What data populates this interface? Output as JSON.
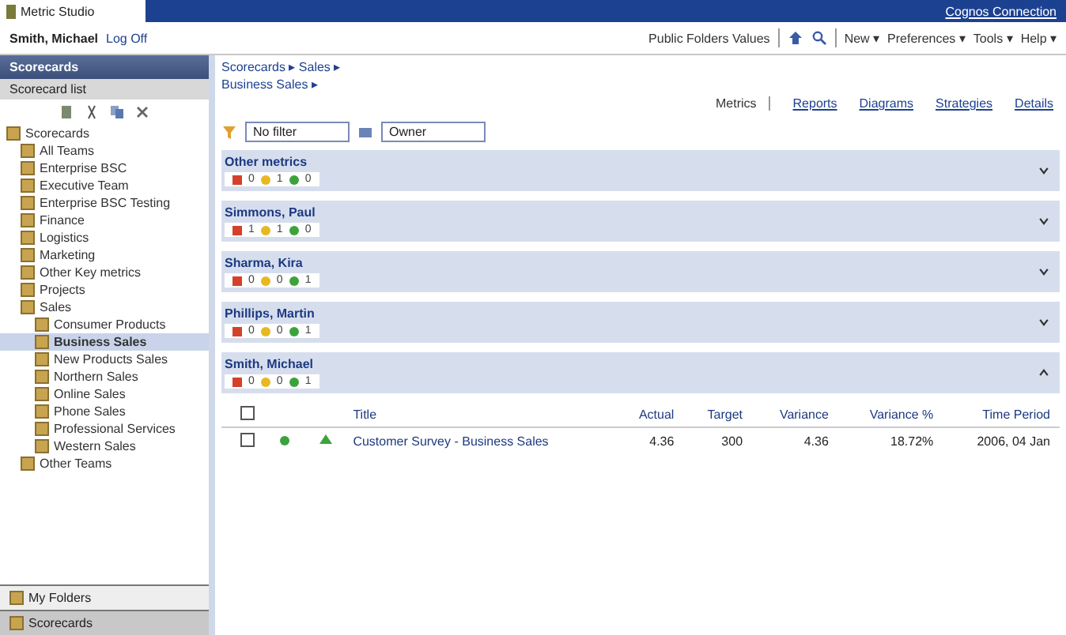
{
  "app_tab": "Metric Studio",
  "cognos_link": "Cognos Connection",
  "user": {
    "name": "Smith, Michael",
    "logoff": "Log Off"
  },
  "toolbar": {
    "folder": "Public Folders Values",
    "menus": [
      "New ▾",
      "Preferences ▾",
      "Tools ▾",
      "Help ▾"
    ]
  },
  "sidebar": {
    "header": "Scorecards",
    "subheader": "Scorecard list",
    "tree": [
      {
        "label": "Scorecards",
        "selected": false,
        "children": [
          {
            "label": "All Teams",
            "selected": false
          },
          {
            "label": "Enterprise BSC",
            "selected": false
          },
          {
            "label": "Executive Team",
            "selected": false
          },
          {
            "label": "Enterprise BSC Testing",
            "selected": false
          },
          {
            "label": "Finance",
            "selected": false
          },
          {
            "label": "Logistics",
            "selected": false
          },
          {
            "label": "Marketing",
            "selected": false
          },
          {
            "label": "Other Key metrics",
            "selected": false
          },
          {
            "label": "Projects",
            "selected": false
          },
          {
            "label": "Sales",
            "selected": false,
            "children": [
              {
                "label": "Consumer Products",
                "selected": false
              },
              {
                "label": "Business Sales",
                "selected": true
              },
              {
                "label": "New Products Sales",
                "selected": false
              },
              {
                "label": "Northern Sales",
                "selected": false
              },
              {
                "label": "Online Sales",
                "selected": false
              },
              {
                "label": "Phone Sales",
                "selected": false
              },
              {
                "label": "Professional Services",
                "selected": false
              },
              {
                "label": "Western Sales",
                "selected": false
              }
            ]
          },
          {
            "label": "Other Teams",
            "selected": false
          }
        ]
      }
    ],
    "bottom": [
      {
        "label": "My Folders",
        "selected": false
      },
      {
        "label": "Scorecards",
        "selected": true
      }
    ]
  },
  "breadcrumb": [
    "Scorecards ▸ Sales ▸",
    "Business Sales ▸"
  ],
  "view_tabs": [
    {
      "label": "Metrics",
      "selected": true
    },
    {
      "label": "Reports",
      "selected": false
    },
    {
      "label": "Diagrams",
      "selected": false
    },
    {
      "label": "Strategies",
      "selected": false
    },
    {
      "label": "Details",
      "selected": false
    }
  ],
  "filters": {
    "filter": "No filter",
    "group": "Owner"
  },
  "groups": [
    {
      "name": "Other metrics",
      "counts": [
        "0",
        "1",
        "0"
      ],
      "expanded": false
    },
    {
      "name": "Simmons, Paul",
      "counts": [
        "1",
        "1",
        "0"
      ],
      "expanded": false
    },
    {
      "name": "Sharma, Kira",
      "counts": [
        "0",
        "0",
        "1"
      ],
      "expanded": false
    },
    {
      "name": "Phillips, Martin",
      "counts": [
        "0",
        "0",
        "1"
      ],
      "expanded": false
    },
    {
      "name": "Smith, Michael",
      "counts": [
        "0",
        "0",
        "1"
      ],
      "expanded": true
    }
  ],
  "table": {
    "select_all_checked": false,
    "columns": [
      "Title",
      "Actual",
      "Target",
      "Variance",
      "Variance %",
      "Time Period"
    ],
    "rows": [
      {
        "checked": false,
        "cells": [
          "Customer Survey - Business Sales",
          "4.36",
          "300",
          "4.36",
          "18.72%",
          "2006, 04 Jan"
        ]
      }
    ]
  }
}
